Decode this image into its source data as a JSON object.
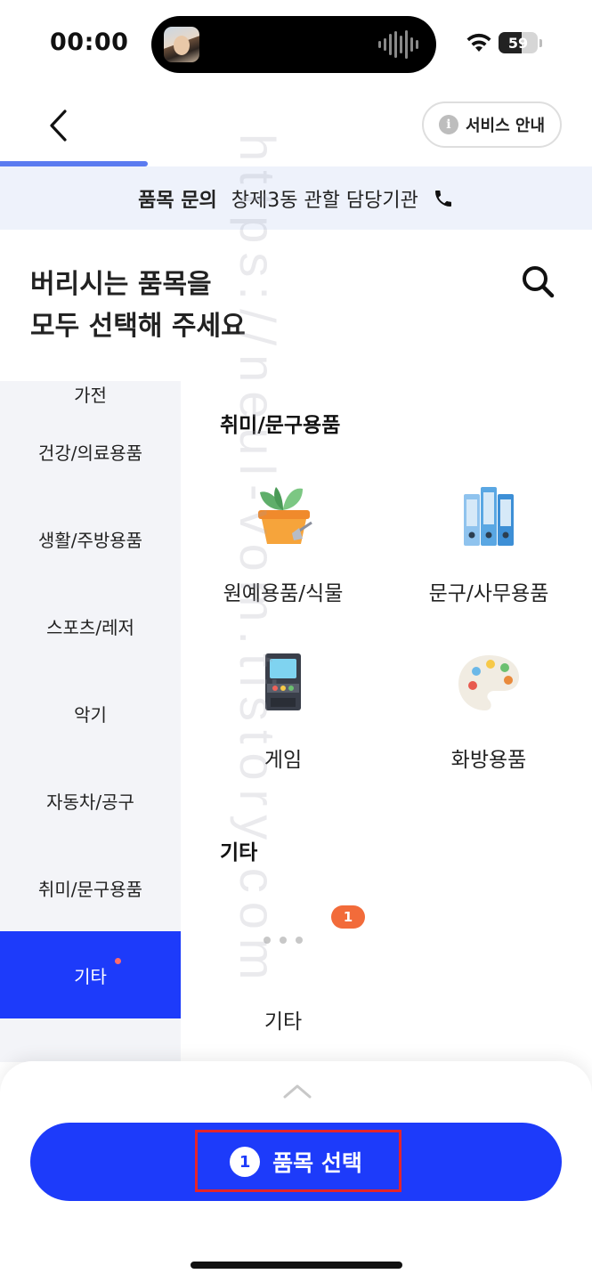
{
  "status_bar": {
    "time": "00:00",
    "battery": "59",
    "battery_level": 0.59
  },
  "header": {
    "service_label": "서비스 안내",
    "progress": 0.25
  },
  "inquiry": {
    "label": "품목 문의",
    "text": "창제3동 관할 담당기관"
  },
  "title": {
    "line1": "버리시는 품목을",
    "line2": "모두 선택해 주세요"
  },
  "sidebar": {
    "items": [
      {
        "label": "가전",
        "active": false,
        "dot": false
      },
      {
        "label": "건강/의료용품",
        "active": false,
        "dot": false
      },
      {
        "label": "생활/주방용품",
        "active": false,
        "dot": false
      },
      {
        "label": "스포츠/레저",
        "active": false,
        "dot": false
      },
      {
        "label": "악기",
        "active": false,
        "dot": false
      },
      {
        "label": "자동차/공구",
        "active": false,
        "dot": false
      },
      {
        "label": "취미/문구용품",
        "active": false,
        "dot": false
      },
      {
        "label": "기타",
        "active": true,
        "dot": true
      }
    ]
  },
  "sections": [
    {
      "title": "취미/문구용품",
      "items": [
        {
          "label": "원예용품/식물",
          "icon": "plant-pot-icon"
        },
        {
          "label": "문구/사무용품",
          "icon": "binders-icon"
        },
        {
          "label": "게임",
          "icon": "arcade-machine-icon"
        },
        {
          "label": "화방용품",
          "icon": "paint-palette-icon"
        }
      ]
    },
    {
      "title": "기타",
      "items": [
        {
          "label": "기타",
          "icon": "more-dots-icon",
          "badge": "1"
        }
      ]
    }
  ],
  "bottom": {
    "count": "1",
    "button_label": "품목 선택"
  },
  "watermark": "https://neul-vom.tistory.com",
  "colors": {
    "primary": "#1d3bfa",
    "badge": "#f26b3a",
    "banner_bg": "#eef2fb",
    "sidebar_bg": "#f3f4f8"
  }
}
